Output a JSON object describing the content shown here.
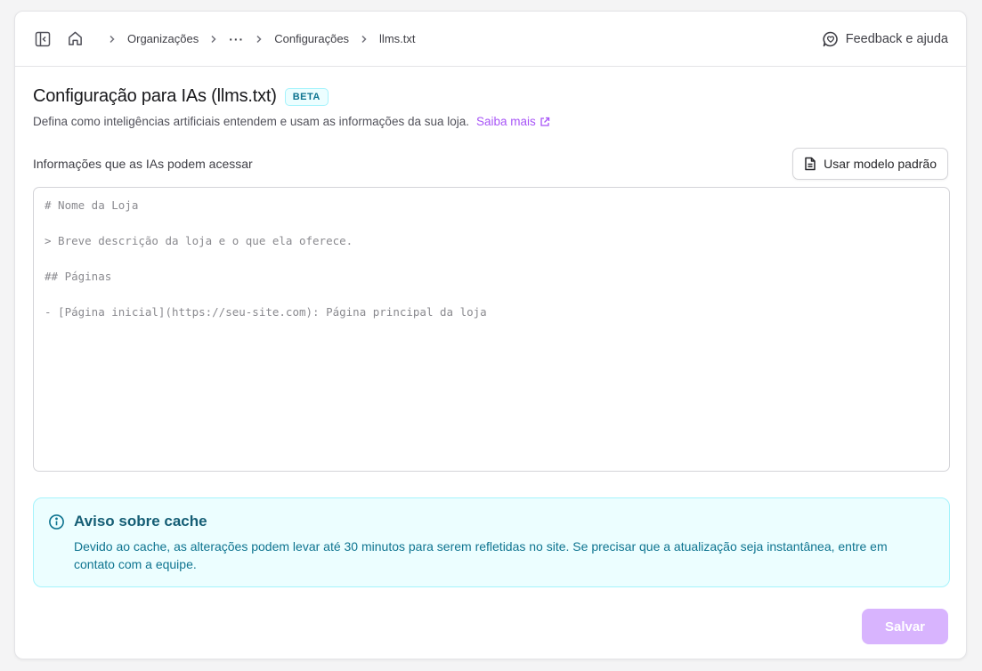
{
  "breadcrumb": {
    "items": [
      "Organizações",
      "Configurações",
      "llms.txt"
    ],
    "ellipsis": "···"
  },
  "header": {
    "feedback_label": "Feedback e ajuda"
  },
  "page": {
    "title": "Configuração para IAs (llms.txt)",
    "badge": "BETA",
    "subtitle": "Defina como inteligências artificiais entendem e usam as informações da sua loja.",
    "learn_more": "Saiba mais"
  },
  "editor": {
    "label": "Informações que as IAs podem acessar",
    "template_button": "Usar modelo padrão",
    "value": "",
    "placeholder": "# Nome da Loja\n\n> Breve descrição da loja e o que ela oferece.\n\n## Páginas\n\n- [Página inicial](https://seu-site.com): Página principal da loja"
  },
  "alert": {
    "title": "Aviso sobre cache",
    "text": "Devido ao cache, as alterações podem levar até 30 minutos para serem refletidas no site. Se precisar que a atualização seja instantânea, entre em contato com a equipe."
  },
  "footer": {
    "save_label": "Salvar"
  },
  "colors": {
    "accent": "#a855f7",
    "save_disabled": "#d8b4fe",
    "info_bg": "#ecfeff",
    "info_border": "#a5f3fc",
    "info_text": "#0e7490"
  },
  "icons": [
    "sidebar-toggle-icon",
    "home-icon",
    "chevron-right-icon",
    "feedback-icon",
    "external-link-icon",
    "document-icon",
    "info-icon"
  ]
}
